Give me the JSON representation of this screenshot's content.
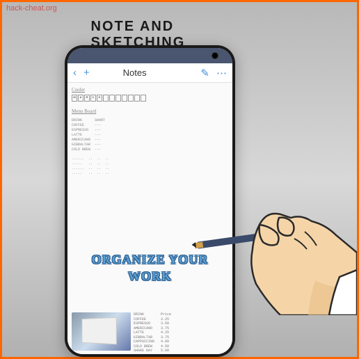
{
  "watermark": "hack-cheat.org",
  "banner": {
    "title": "NOTE AND SKETCHING"
  },
  "app": {
    "nav": {
      "title": "Notes",
      "back_icon": "‹",
      "add_icon": "+",
      "edit_icon": "✎",
      "menu_icon": "⋯"
    },
    "sketch": {
      "header1": "Cooler",
      "calendar_label": "MARCH",
      "header2": "Menu Board",
      "columns": "DRINK      SHORT\nCOFFEE     ---\nESPRESSO   ---\nLATTE      ---\nAMERICANO  ---\nGIBRALTAR  ---\nCOLD BREW  ---",
      "dots": "......  ..  ..  ..\n.....   ..  ..  ..\n......  ..  ..  ..\n.....   ..  ..  .."
    },
    "stylized": {
      "line1": "ORGANIZE YOUR",
      "line2": "WORK"
    },
    "pricelist": "DRINK        Price\nCOFFEE       3.25\nESPRESSO     3.50\nAMERICANO    3.75\nLATTE        4.25\nGIBRALTAR    3.75\nCAPPUCCINO   4.00\nCOLD BREW    4.50\nSHAKE DAY    5.00"
  }
}
